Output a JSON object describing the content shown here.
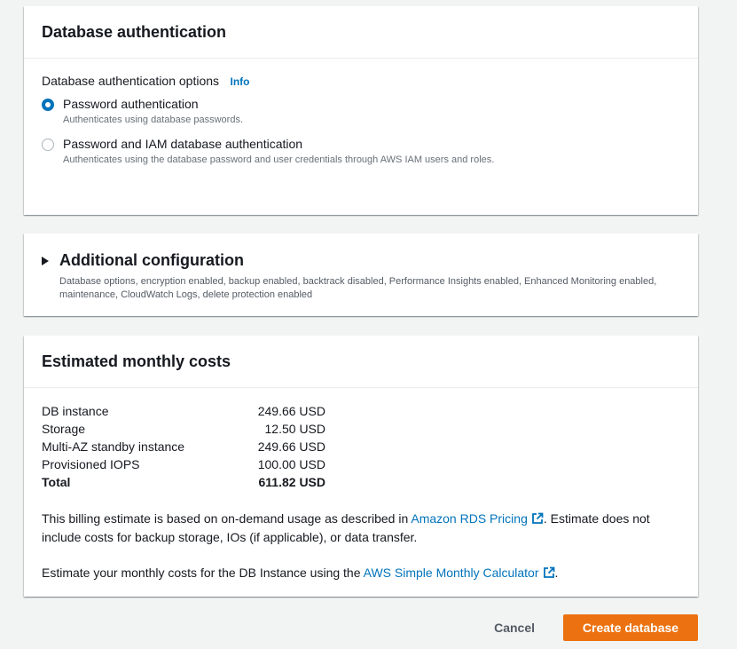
{
  "auth": {
    "title": "Database authentication",
    "options_label": "Database authentication options",
    "info_label": "Info",
    "options": [
      {
        "label": "Password authentication",
        "description": "Authenticates using database passwords.",
        "selected": true
      },
      {
        "label": "Password and IAM database authentication",
        "description": "Authenticates using the database password and user credentials through AWS IAM users and roles.",
        "selected": false
      }
    ]
  },
  "additional": {
    "title": "Additional configuration",
    "description": "Database options, encryption enabled, backup enabled, backtrack disabled, Performance Insights enabled, Enhanced Monitoring enabled, maintenance, CloudWatch Logs, delete protection enabled"
  },
  "costs": {
    "title": "Estimated monthly costs",
    "rows": [
      {
        "name": "DB instance",
        "value": "249.66 USD"
      },
      {
        "name": "Storage",
        "value": "12.50 USD"
      },
      {
        "name": "Multi-AZ standby instance",
        "value": "249.66 USD"
      },
      {
        "name": "Provisioned IOPS",
        "value": "100.00 USD"
      }
    ],
    "total": {
      "name": "Total",
      "value": "611.82 USD"
    },
    "billing_text_before": "This billing estimate is based on on-demand usage as described in ",
    "billing_link": "Amazon RDS Pricing",
    "billing_text_after": ". Estimate does not include costs for backup storage, IOs (if applicable), or data transfer.",
    "calc_text_before": "Estimate your monthly costs for the DB Instance using the ",
    "calc_link": "AWS Simple Monthly Calculator",
    "calc_text_after": "."
  },
  "footer": {
    "cancel_label": "Cancel",
    "create_label": "Create database"
  },
  "colors": {
    "link": "#0073bb",
    "primary_button": "#ec7211",
    "background": "#f2f3f3"
  }
}
